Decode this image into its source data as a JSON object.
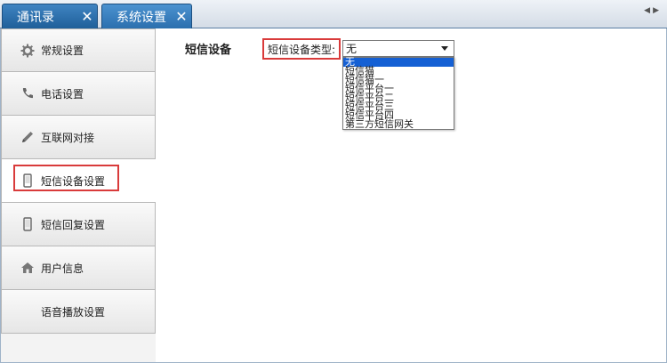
{
  "tabs": [
    {
      "label": "通讯录",
      "close": "✕"
    },
    {
      "label": "系统设置",
      "close": "✕"
    }
  ],
  "tab_scroll": "◀▶",
  "sidebar": {
    "items": [
      {
        "label": "常规设置",
        "icon": "gear-icon"
      },
      {
        "label": "电话设置",
        "icon": "phone-icon"
      },
      {
        "label": "互联网对接",
        "icon": "pencil-icon"
      },
      {
        "label": "短信设备设置",
        "icon": "mobile-icon"
      },
      {
        "label": "短信回复设置",
        "icon": "mobile-icon"
      },
      {
        "label": "用户信息",
        "icon": "house-icon"
      },
      {
        "label": "语音播放设置",
        "icon": ""
      }
    ],
    "active_index": 3
  },
  "main": {
    "section_title": "短信设备",
    "type_label": "短信设备类型:",
    "select": {
      "value": "无",
      "options": [
        "无",
        "短信猫",
        "短信猫一",
        "短信平台一",
        "短信平台二",
        "短信平台三",
        "短信平台四",
        "第三方短信网关"
      ],
      "selected_index": 0
    }
  },
  "colors": {
    "tab_blue": "#2b6fae",
    "highlight_red": "#d93b3b",
    "option_selected": "#1560d4"
  }
}
